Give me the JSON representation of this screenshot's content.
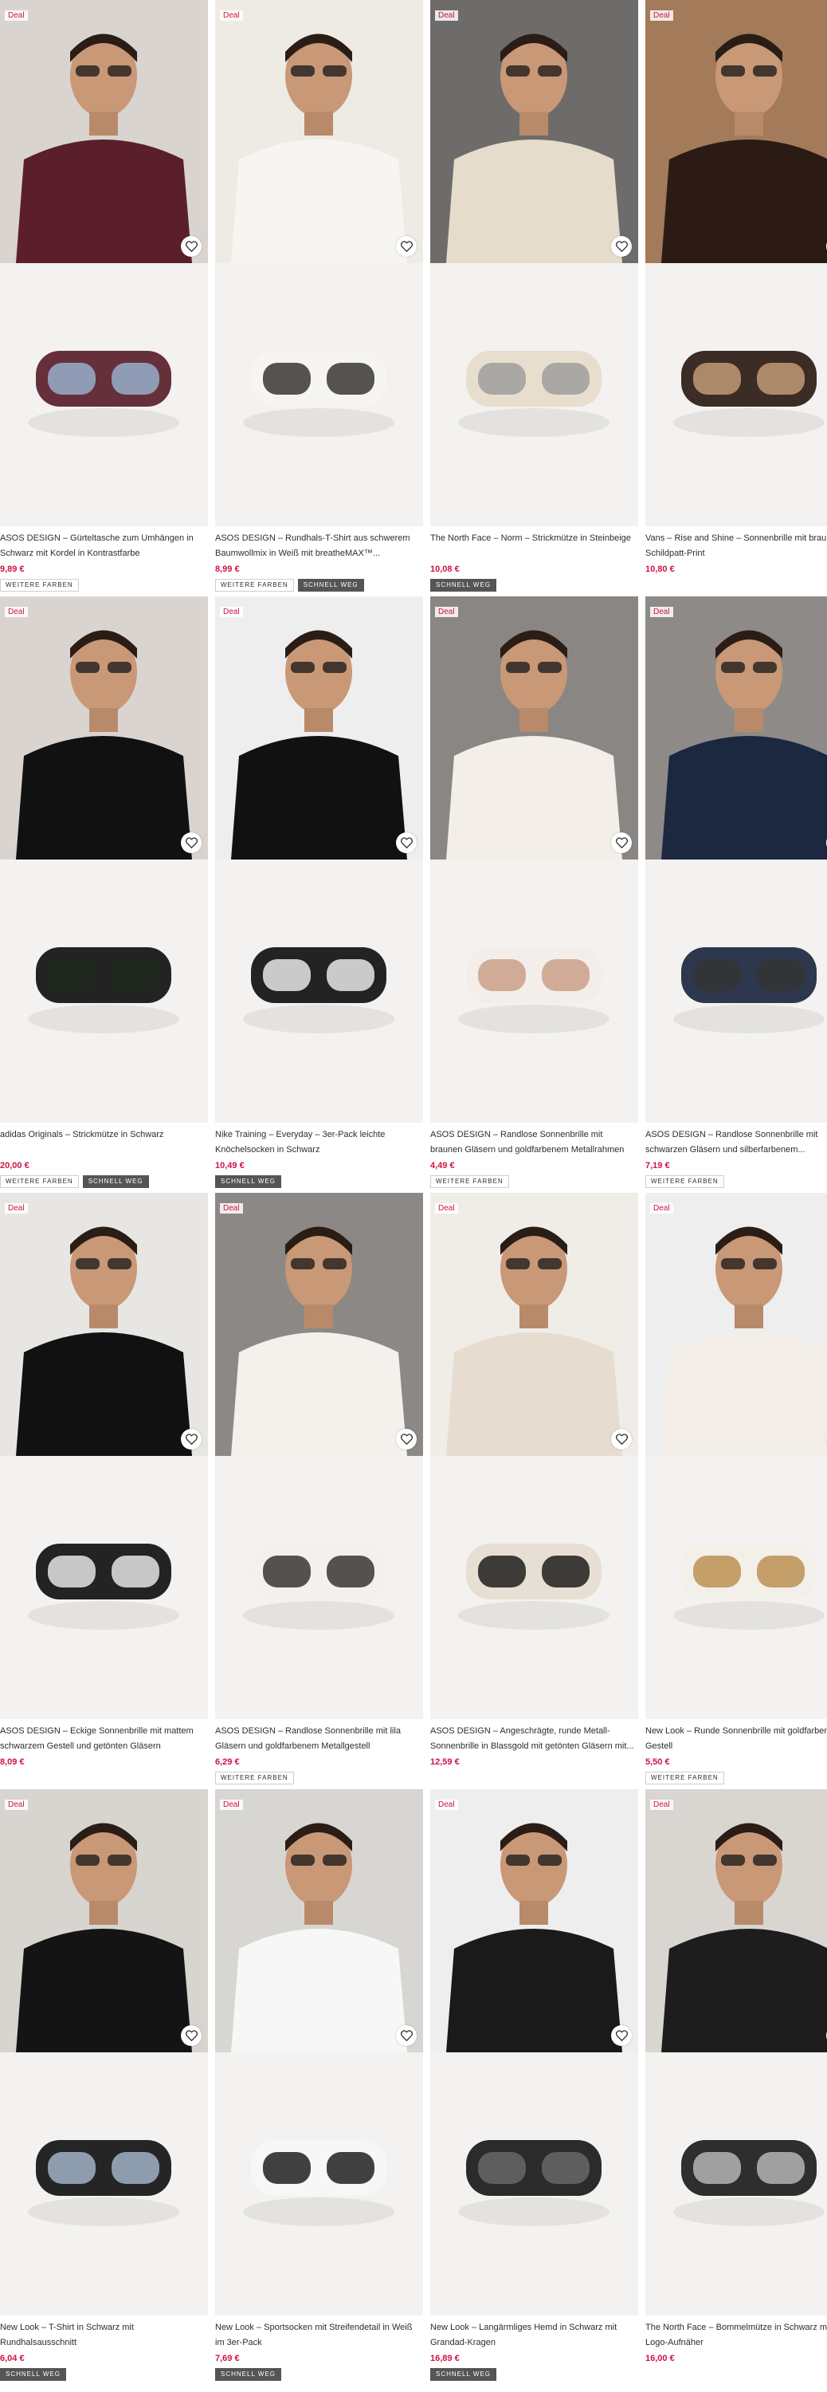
{
  "colors": {
    "price": "#d01345",
    "deal": "#d01345",
    "badge_dark": "#555555"
  },
  "products": [
    {
      "deal": "Deal",
      "name": "ASOS DESIGN – Gürteltasche zum Umhängen in Schwarz mit Kordel in Kontrastfarbe",
      "price": "9,89 €",
      "badges": [
        "WEITERE FARBEN"
      ],
      "dark_badges": []
    },
    {
      "deal": "Deal",
      "name": "ASOS DESIGN – Rundhals-T-Shirt aus schwerem Baumwollmix in Weiß mit breatheMAX™...",
      "price": "8,99 €",
      "badges": [
        "WEITERE FARBEN"
      ],
      "dark_badges": [
        "SCHNELL WEG"
      ]
    },
    {
      "deal": "Deal",
      "name": "The North Face – Norm – Strickmütze in Steinbeige",
      "price": "10,08 €",
      "badges": [],
      "dark_badges": [
        "SCHNELL WEG"
      ]
    },
    {
      "deal": "Deal",
      "name": "Vans – Rise and Shine – Sonnenbrille mit braunem Schildpatt-Print",
      "price": "10,80 €",
      "badges": [],
      "dark_badges": []
    },
    {
      "deal": "Deal",
      "name": "adidas Originals – Strickmütze in Schwarz",
      "price": "20,00 €",
      "badges": [
        "WEITERE FARBEN"
      ],
      "dark_badges": [
        "SCHNELL WEG"
      ]
    },
    {
      "deal": "Deal",
      "name": "Nike Training – Everyday – 3er-Pack leichte Knöchelsocken in Schwarz",
      "price": "10,49 €",
      "badges": [],
      "dark_badges": [
        "SCHNELL WEG"
      ]
    },
    {
      "deal": "Deal",
      "name": "ASOS DESIGN – Randlose Sonnenbrille mit braunen Gläsern und goldfarbenem Metallrahmen",
      "price": "4,49 €",
      "badges": [
        "WEITERE FARBEN"
      ],
      "dark_badges": []
    },
    {
      "deal": "Deal",
      "name": "ASOS DESIGN – Randlose Sonnenbrille mit schwarzen Gläsern und silberfarbenem...",
      "price": "7,19 €",
      "badges": [
        "WEITERE FARBEN"
      ],
      "dark_badges": []
    },
    {
      "deal": "Deal",
      "name": "ASOS DESIGN – Eckige Sonnenbrille mit mattem schwarzem Gestell und getönten Gläsern",
      "price": "8,09 €",
      "badges": [],
      "dark_badges": []
    },
    {
      "deal": "Deal",
      "name": "ASOS DESIGN – Randlose Sonnenbrille mit lila Gläsern und goldfarbenem Metallgestell",
      "price": "6,29 €",
      "badges": [
        "WEITERE FARBEN"
      ],
      "dark_badges": []
    },
    {
      "deal": "Deal",
      "name": "ASOS DESIGN – Angeschrägte, runde Metall-Sonnenbrille in Blassgold mit getönten Gläsern mit...",
      "price": "12,59 €",
      "badges": [],
      "dark_badges": []
    },
    {
      "deal": "Deal",
      "name": "New Look – Runde Sonnenbrille mit goldfarbenem Gestell",
      "price": "5,50 €",
      "badges": [
        "WEITERE FARBEN"
      ],
      "dark_badges": []
    },
    {
      "deal": "Deal",
      "name": "New Look – T-Shirt in Schwarz mit Rundhalsausschnitt",
      "price": "6,04 €",
      "badges": [],
      "dark_badges": [
        "SCHNELL WEG"
      ]
    },
    {
      "deal": "Deal",
      "name": "New Look – Sportsocken mit Streifendetail in Weiß im 3er-Pack",
      "price": "7,69 €",
      "badges": [],
      "dark_badges": [
        "SCHNELL WEG"
      ]
    },
    {
      "deal": "Deal",
      "name": "New Look – Langärmliges Hemd in Schwarz mit Grandad-Kragen",
      "price": "16,89 €",
      "badges": [],
      "dark_badges": [
        "SCHNELL WEG"
      ]
    },
    {
      "deal": "Deal",
      "name": "The North Face – Bommelmütze in Schwarz mit Logo-Aufnäher",
      "price": "16,00 €",
      "badges": [],
      "dark_badges": []
    }
  ]
}
